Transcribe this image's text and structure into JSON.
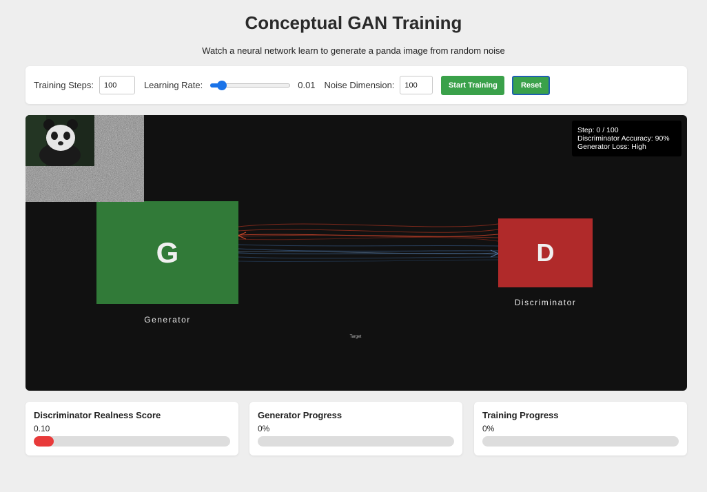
{
  "header": {
    "title": "Conceptual GAN Training",
    "subtitle": "Watch a neural network learn to generate a panda image from random noise"
  },
  "controls": {
    "steps_label": "Training Steps:",
    "steps_value": "100",
    "lr_label": "Learning Rate:",
    "lr_value": "0.01",
    "lr_slider_fraction": 0.1,
    "noise_label": "Noise Dimension:",
    "noise_value": "100",
    "start_label": "Start Training",
    "reset_label": "Reset"
  },
  "canvas": {
    "status": {
      "step": "Step: 0 / 100",
      "accuracy": "Discriminator Accuracy: 90%",
      "loss": "Generator Loss: High"
    },
    "generator": {
      "letter": "G",
      "label": "Generator"
    },
    "discriminator": {
      "letter": "D",
      "label": "Discriminator"
    },
    "target_label": "Target"
  },
  "metrics": [
    {
      "title": "Discriminator Realness Score",
      "value": "0.10",
      "fraction": 0.1,
      "color": "#e83a3a"
    },
    {
      "title": "Generator Progress",
      "value": "0%",
      "fraction": 0,
      "color": "#3aa14a"
    },
    {
      "title": "Training Progress",
      "value": "0%",
      "fraction": 0,
      "color": "#1a73e8"
    }
  ],
  "colors": {
    "accent_green": "#3aa14a",
    "generator_green": "#317a38",
    "discriminator_red": "#b02a2a",
    "slider_blue": "#1a73e8",
    "canvas_bg": "#111111"
  }
}
